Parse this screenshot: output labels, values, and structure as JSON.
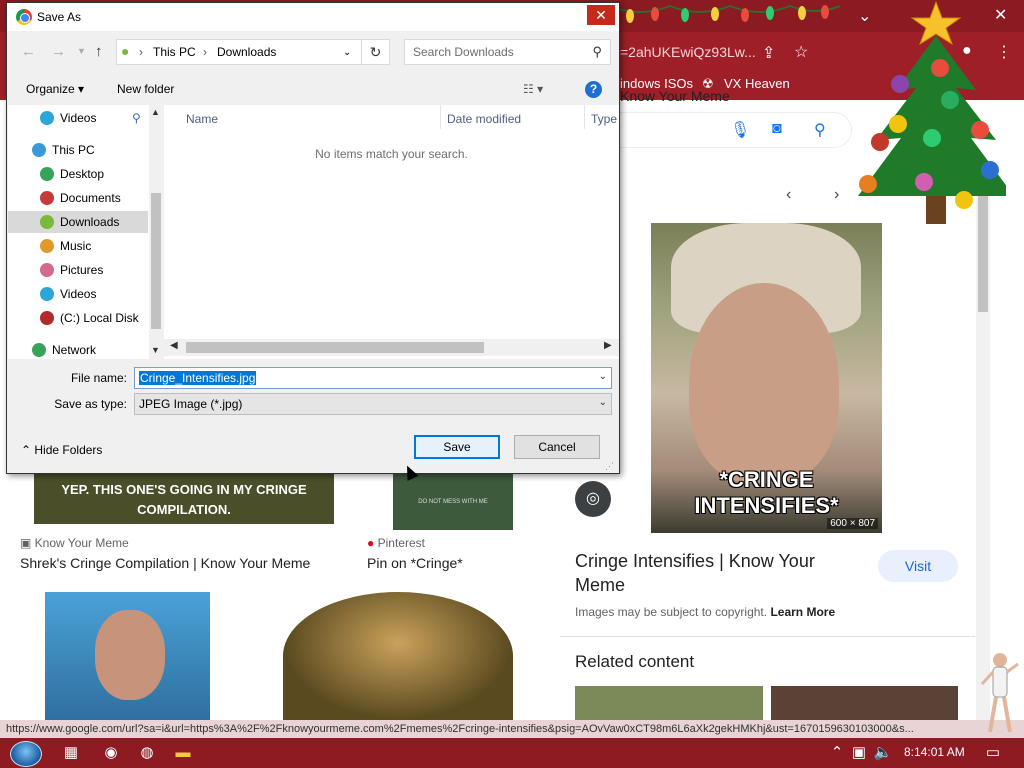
{
  "dialog": {
    "title": "Save As",
    "close_glyph": "✕",
    "breadcrumb": [
      "This PC",
      "Downloads"
    ],
    "search_placeholder": "Search Downloads",
    "organize_label": "Organize ▾",
    "new_folder_label": "New folder",
    "nav_items": [
      {
        "label": "Videos",
        "color": "#2aa7d8"
      },
      {
        "label": "This PC",
        "color": "#3a9ad9"
      },
      {
        "label": "Desktop",
        "color": "#35a35a"
      },
      {
        "label": "Documents",
        "color": "#c8393b"
      },
      {
        "label": "Downloads",
        "color": "#7cb83c"
      },
      {
        "label": "Music",
        "color": "#e09a2c"
      },
      {
        "label": "Pictures",
        "color": "#d16a8c"
      },
      {
        "label": "Videos",
        "color": "#2aa7d8"
      },
      {
        "label": "(C:) Local Disk",
        "color": "#b22a2a"
      },
      {
        "label": "Network",
        "color": "#3aa35a"
      }
    ],
    "columns": [
      "Name",
      "Date modified",
      "Type"
    ],
    "empty_message": "No items match your search.",
    "file_name_label": "File name:",
    "file_name_value": "Cringe_Intensifies.jpg",
    "save_as_type_label": "Save as type:",
    "save_as_type_value": "JPEG Image (*.jpg)",
    "hide_folders_label": "Hide Folders",
    "save_button": "Save",
    "cancel_button": "Cancel"
  },
  "browser": {
    "url_fragment": "=2ahUKEwiQz93Lw...",
    "bookmarks": [
      "indows ISOs",
      "VX Heaven"
    ],
    "panel_source": "Know Your Meme",
    "main_image_caption": "*CRINGE INTENSIFIES*",
    "main_image_dims": "600 × 807",
    "result_title": "Cringe Intensifies | Know Your Meme",
    "visit_label": "Visit",
    "copyright_text": "Images may be subject to copyright.",
    "learn_more": "Learn More",
    "related_heading": "Related content",
    "results": [
      {
        "source": "Know Your Meme",
        "title": "Shrek's Cringe Compilation | Know Your Meme",
        "overlay": "YEP. THIS ONE'S GOING IN MY CRINGE COMPILATION."
      },
      {
        "source": "Pinterest",
        "title": "Pin on *Cringe*",
        "overlay": "DO NOT MESS WITH ME"
      }
    ],
    "status_url": "https://www.google.com/url?sa=i&url=https%3A%2F%2Fknowyourmeme.com%2Fmemes%2Fcringe-intensifies&psig=AOvVaw0xCT98m6L6aXk2gekHMKhj&ust=1670159630103000&s..."
  },
  "taskbar": {
    "clock": "8:14:01 AM"
  }
}
